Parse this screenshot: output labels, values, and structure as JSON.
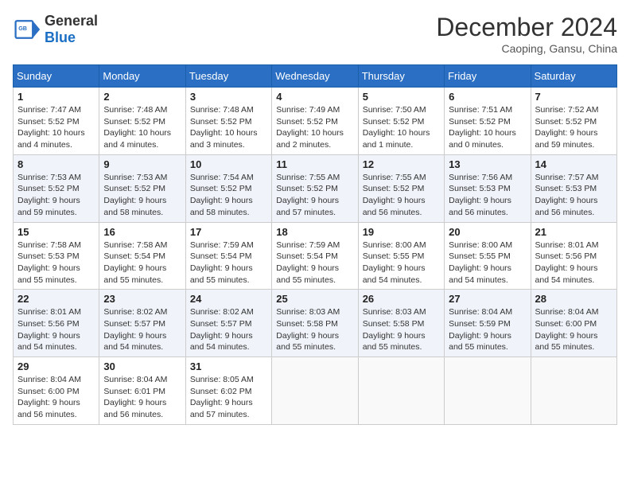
{
  "header": {
    "logo_general": "General",
    "logo_blue": "Blue",
    "month_title": "December 2024",
    "location": "Caoping, Gansu, China"
  },
  "weekdays": [
    "Sunday",
    "Monday",
    "Tuesday",
    "Wednesday",
    "Thursday",
    "Friday",
    "Saturday"
  ],
  "weeks": [
    [
      {
        "day": "1",
        "sunrise": "Sunrise: 7:47 AM",
        "sunset": "Sunset: 5:52 PM",
        "daylight": "Daylight: 10 hours and 4 minutes."
      },
      {
        "day": "2",
        "sunrise": "Sunrise: 7:48 AM",
        "sunset": "Sunset: 5:52 PM",
        "daylight": "Daylight: 10 hours and 4 minutes."
      },
      {
        "day": "3",
        "sunrise": "Sunrise: 7:48 AM",
        "sunset": "Sunset: 5:52 PM",
        "daylight": "Daylight: 10 hours and 3 minutes."
      },
      {
        "day": "4",
        "sunrise": "Sunrise: 7:49 AM",
        "sunset": "Sunset: 5:52 PM",
        "daylight": "Daylight: 10 hours and 2 minutes."
      },
      {
        "day": "5",
        "sunrise": "Sunrise: 7:50 AM",
        "sunset": "Sunset: 5:52 PM",
        "daylight": "Daylight: 10 hours and 1 minute."
      },
      {
        "day": "6",
        "sunrise": "Sunrise: 7:51 AM",
        "sunset": "Sunset: 5:52 PM",
        "daylight": "Daylight: 10 hours and 0 minutes."
      },
      {
        "day": "7",
        "sunrise": "Sunrise: 7:52 AM",
        "sunset": "Sunset: 5:52 PM",
        "daylight": "Daylight: 9 hours and 59 minutes."
      }
    ],
    [
      {
        "day": "8",
        "sunrise": "Sunrise: 7:53 AM",
        "sunset": "Sunset: 5:52 PM",
        "daylight": "Daylight: 9 hours and 59 minutes."
      },
      {
        "day": "9",
        "sunrise": "Sunrise: 7:53 AM",
        "sunset": "Sunset: 5:52 PM",
        "daylight": "Daylight: 9 hours and 58 minutes."
      },
      {
        "day": "10",
        "sunrise": "Sunrise: 7:54 AM",
        "sunset": "Sunset: 5:52 PM",
        "daylight": "Daylight: 9 hours and 58 minutes."
      },
      {
        "day": "11",
        "sunrise": "Sunrise: 7:55 AM",
        "sunset": "Sunset: 5:52 PM",
        "daylight": "Daylight: 9 hours and 57 minutes."
      },
      {
        "day": "12",
        "sunrise": "Sunrise: 7:55 AM",
        "sunset": "Sunset: 5:52 PM",
        "daylight": "Daylight: 9 hours and 56 minutes."
      },
      {
        "day": "13",
        "sunrise": "Sunrise: 7:56 AM",
        "sunset": "Sunset: 5:53 PM",
        "daylight": "Daylight: 9 hours and 56 minutes."
      },
      {
        "day": "14",
        "sunrise": "Sunrise: 7:57 AM",
        "sunset": "Sunset: 5:53 PM",
        "daylight": "Daylight: 9 hours and 56 minutes."
      }
    ],
    [
      {
        "day": "15",
        "sunrise": "Sunrise: 7:58 AM",
        "sunset": "Sunset: 5:53 PM",
        "daylight": "Daylight: 9 hours and 55 minutes."
      },
      {
        "day": "16",
        "sunrise": "Sunrise: 7:58 AM",
        "sunset": "Sunset: 5:54 PM",
        "daylight": "Daylight: 9 hours and 55 minutes."
      },
      {
        "day": "17",
        "sunrise": "Sunrise: 7:59 AM",
        "sunset": "Sunset: 5:54 PM",
        "daylight": "Daylight: 9 hours and 55 minutes."
      },
      {
        "day": "18",
        "sunrise": "Sunrise: 7:59 AM",
        "sunset": "Sunset: 5:54 PM",
        "daylight": "Daylight: 9 hours and 55 minutes."
      },
      {
        "day": "19",
        "sunrise": "Sunrise: 8:00 AM",
        "sunset": "Sunset: 5:55 PM",
        "daylight": "Daylight: 9 hours and 54 minutes."
      },
      {
        "day": "20",
        "sunrise": "Sunrise: 8:00 AM",
        "sunset": "Sunset: 5:55 PM",
        "daylight": "Daylight: 9 hours and 54 minutes."
      },
      {
        "day": "21",
        "sunrise": "Sunrise: 8:01 AM",
        "sunset": "Sunset: 5:56 PM",
        "daylight": "Daylight: 9 hours and 54 minutes."
      }
    ],
    [
      {
        "day": "22",
        "sunrise": "Sunrise: 8:01 AM",
        "sunset": "Sunset: 5:56 PM",
        "daylight": "Daylight: 9 hours and 54 minutes."
      },
      {
        "day": "23",
        "sunrise": "Sunrise: 8:02 AM",
        "sunset": "Sunset: 5:57 PM",
        "daylight": "Daylight: 9 hours and 54 minutes."
      },
      {
        "day": "24",
        "sunrise": "Sunrise: 8:02 AM",
        "sunset": "Sunset: 5:57 PM",
        "daylight": "Daylight: 9 hours and 54 minutes."
      },
      {
        "day": "25",
        "sunrise": "Sunrise: 8:03 AM",
        "sunset": "Sunset: 5:58 PM",
        "daylight": "Daylight: 9 hours and 55 minutes."
      },
      {
        "day": "26",
        "sunrise": "Sunrise: 8:03 AM",
        "sunset": "Sunset: 5:58 PM",
        "daylight": "Daylight: 9 hours and 55 minutes."
      },
      {
        "day": "27",
        "sunrise": "Sunrise: 8:04 AM",
        "sunset": "Sunset: 5:59 PM",
        "daylight": "Daylight: 9 hours and 55 minutes."
      },
      {
        "day": "28",
        "sunrise": "Sunrise: 8:04 AM",
        "sunset": "Sunset: 6:00 PM",
        "daylight": "Daylight: 9 hours and 55 minutes."
      }
    ],
    [
      {
        "day": "29",
        "sunrise": "Sunrise: 8:04 AM",
        "sunset": "Sunset: 6:00 PM",
        "daylight": "Daylight: 9 hours and 56 minutes."
      },
      {
        "day": "30",
        "sunrise": "Sunrise: 8:04 AM",
        "sunset": "Sunset: 6:01 PM",
        "daylight": "Daylight: 9 hours and 56 minutes."
      },
      {
        "day": "31",
        "sunrise": "Sunrise: 8:05 AM",
        "sunset": "Sunset: 6:02 PM",
        "daylight": "Daylight: 9 hours and 57 minutes."
      },
      null,
      null,
      null,
      null
    ]
  ]
}
